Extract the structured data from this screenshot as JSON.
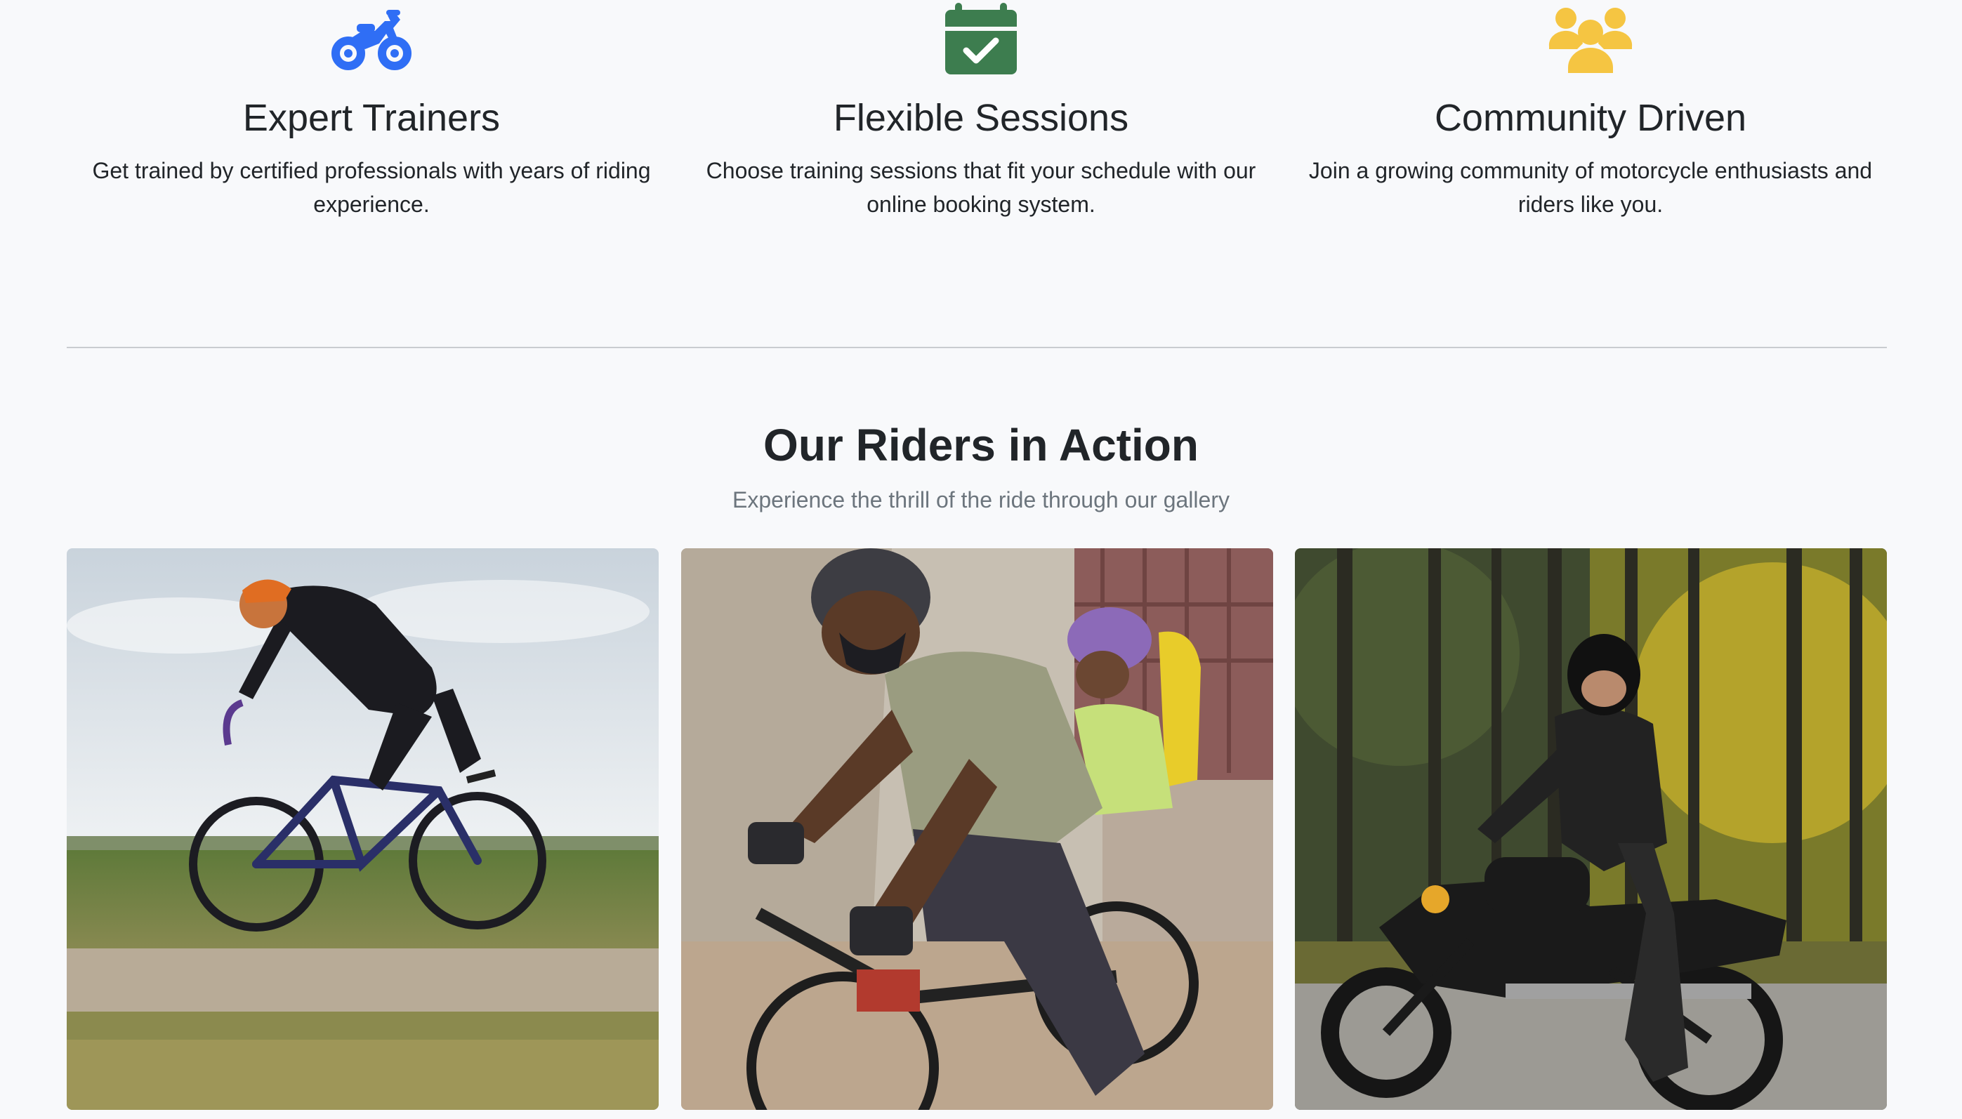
{
  "features": [
    {
      "icon": "motorcycle-icon",
      "icon_color": "#2f6ef5",
      "title": "Expert Trainers",
      "text": "Get trained by certified professionals with years of riding experience."
    },
    {
      "icon": "calendar-check-icon",
      "icon_color": "#3d7d4f",
      "title": "Flexible Sessions",
      "text": "Choose training sessions that fit your schedule with our online booking system."
    },
    {
      "icon": "users-icon",
      "icon_color": "#f5c542",
      "title": "Community Driven",
      "text": "Join a growing community of motorcycle enthusiasts and riders like you."
    }
  ],
  "gallery": {
    "title": "Our Riders in Action",
    "subtitle": "Experience the thrill of the ride through our gallery",
    "photos": [
      {
        "subject": "road cyclist riding past a field"
      },
      {
        "subject": "man with child riding an electric bike"
      },
      {
        "subject": "rider on a black motorcycle in an autumn forest"
      }
    ]
  },
  "colors": {
    "background": "#f8f9fb",
    "text": "#212529",
    "muted": "#6c757d",
    "divider": "#c9ccd0"
  }
}
